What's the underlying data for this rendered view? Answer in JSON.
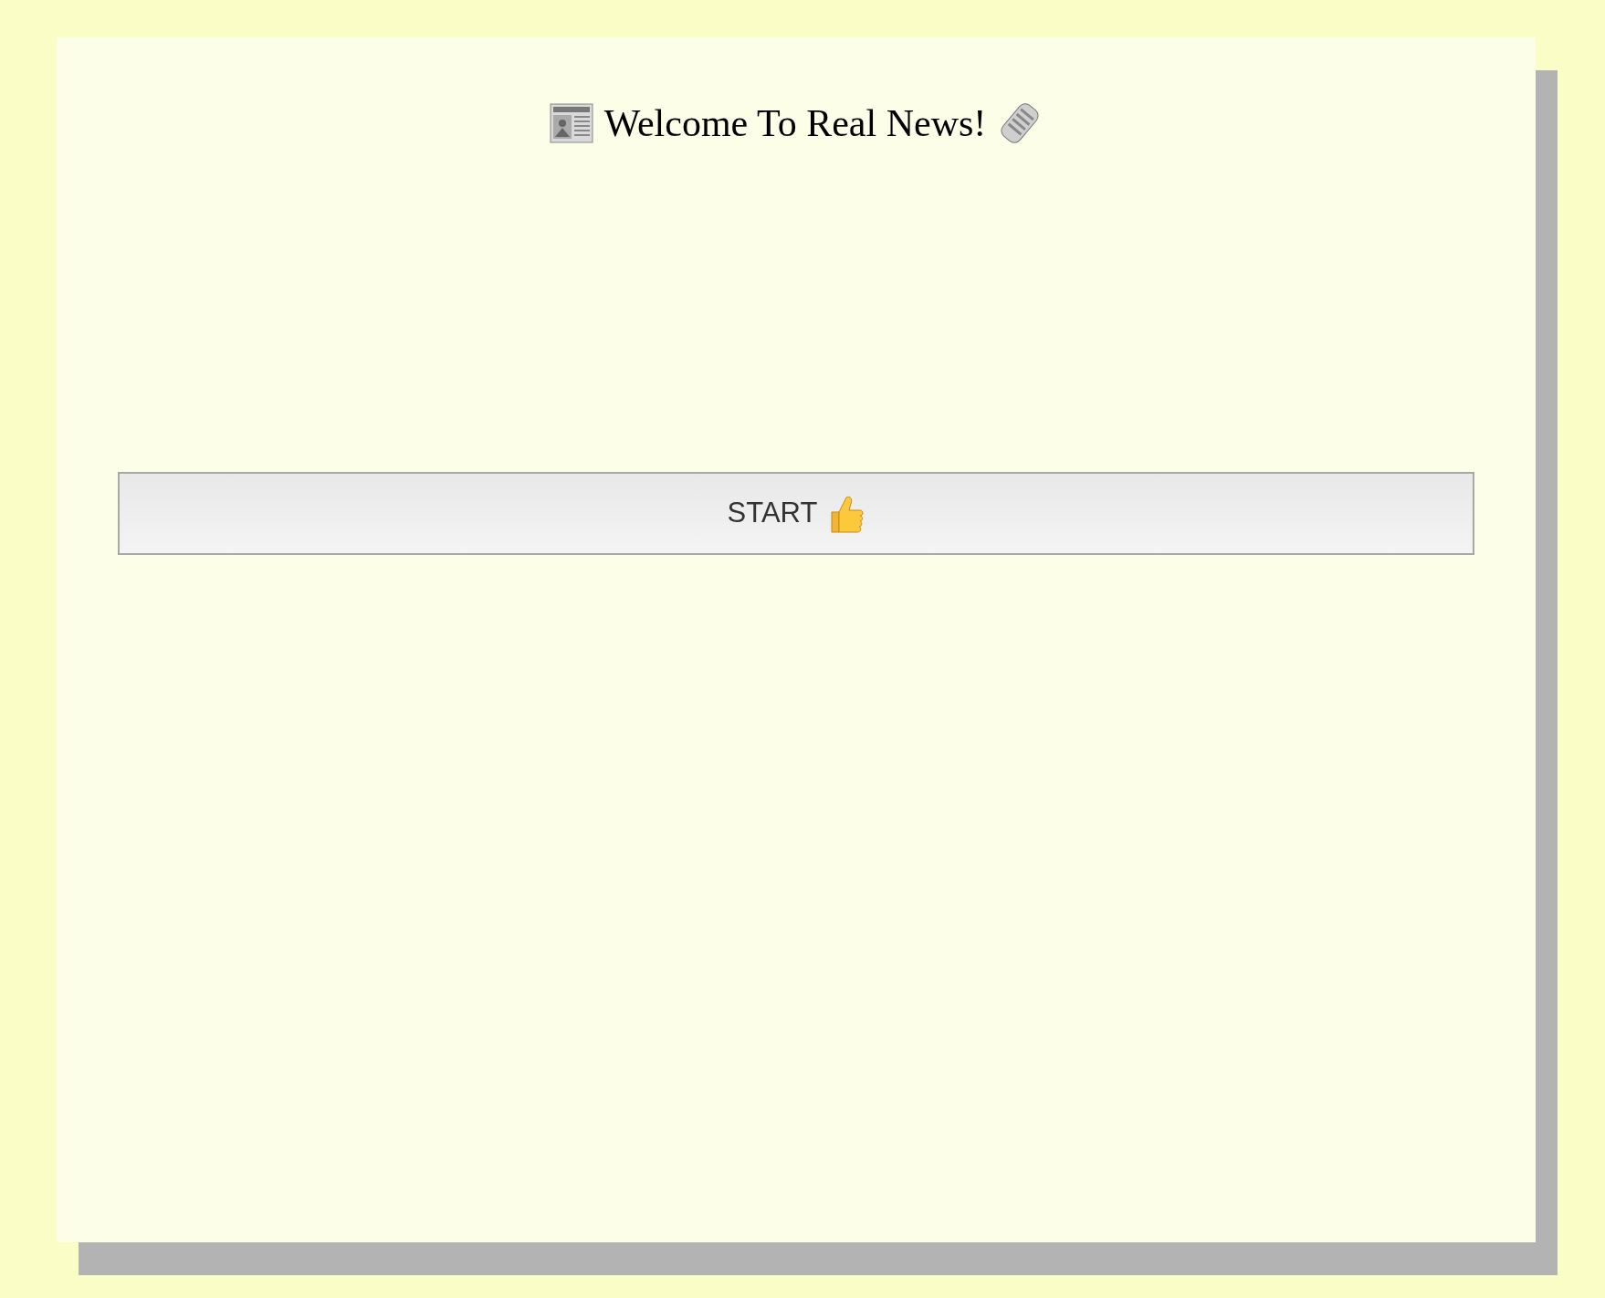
{
  "title": "Welcome To Real News!",
  "start_button": {
    "label": "START"
  }
}
